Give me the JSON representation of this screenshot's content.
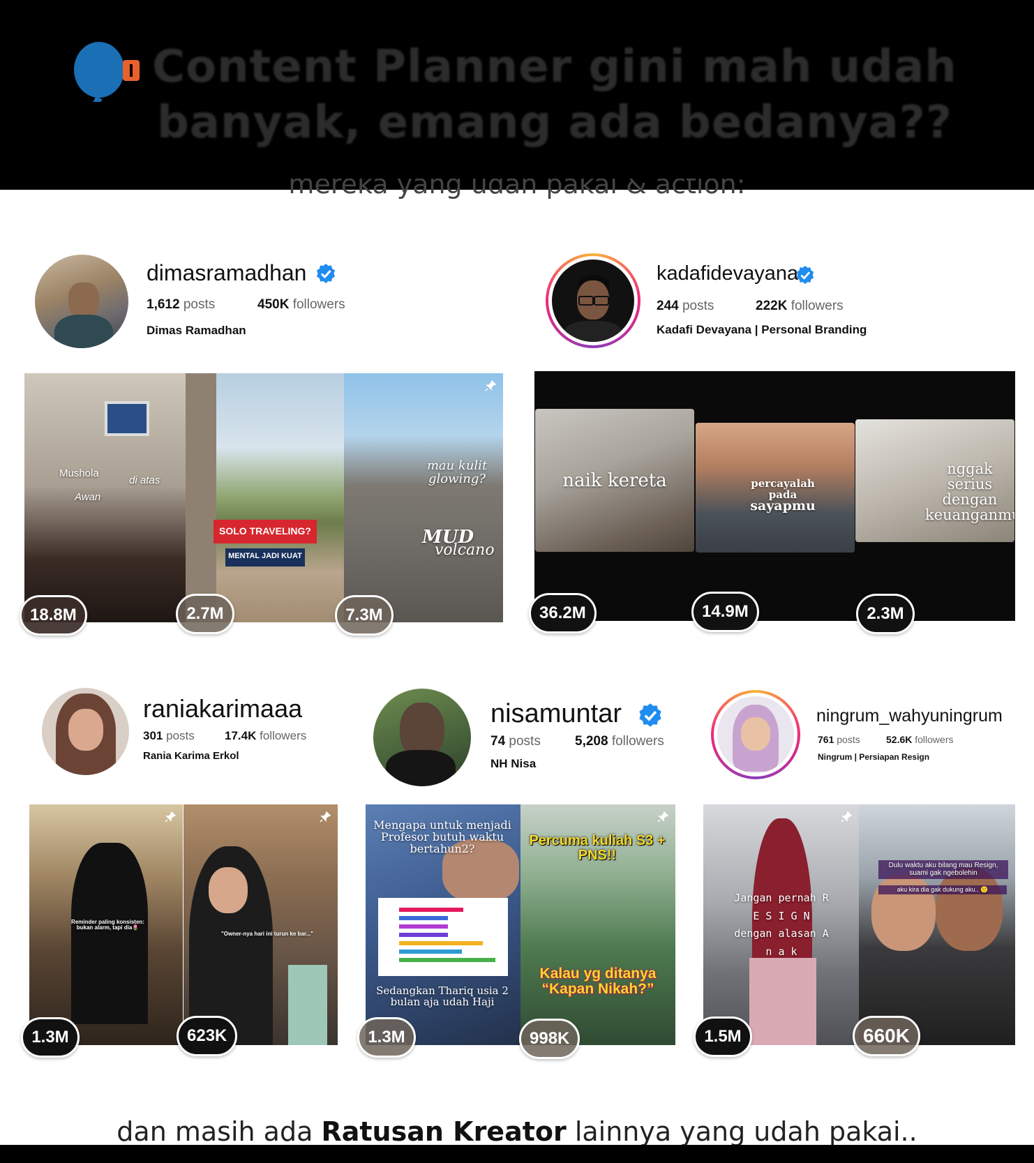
{
  "header": {
    "headline_line1": "Content Planner gini mah udah",
    "headline_line2": "banyak, emang ada bedanya??",
    "subline": "mereka yang udah pakai & action:"
  },
  "profiles": [
    {
      "username": "dimasramadhan",
      "posts": "1,612",
      "posts_label": "posts",
      "followers": "450K",
      "followers_label": "followers",
      "display_name": "Dimas Ramadhan",
      "verified": true,
      "thumbs": [
        {
          "views": "18.8M"
        },
        {
          "views": "2.7M"
        },
        {
          "views": "7.3M"
        }
      ]
    },
    {
      "username": "kadafidevayana",
      "posts": "244",
      "posts_label": "posts",
      "followers": "222K",
      "followers_label": "followers",
      "display_name": "Kadafi Devayana | Personal Branding",
      "verified": true,
      "thumbs": [
        {
          "views": "36.2M"
        },
        {
          "views": "14.9M"
        },
        {
          "views": "2.3M"
        }
      ]
    },
    {
      "username": "raniakarimaaa",
      "posts": "301",
      "posts_label": "posts",
      "followers": "17.4K",
      "followers_label": "followers",
      "display_name": "Rania Karima Erkol",
      "verified": false,
      "thumbs": [
        {
          "views": "1.3M"
        },
        {
          "views": "623K"
        }
      ]
    },
    {
      "username": "nisamuntar",
      "posts": "74",
      "posts_label": "posts",
      "followers": "5,208",
      "followers_label": "followers",
      "display_name": "NH Nisa",
      "verified": true,
      "thumbs": [
        {
          "views": "1.3M"
        },
        {
          "views": "998K"
        }
      ]
    },
    {
      "username": "ningrum_wahyuningrum",
      "posts": "761",
      "posts_label": "posts",
      "followers": "52.6K",
      "followers_label": "followers",
      "display_name": "Ningrum | Persiapan Resign",
      "verified": false,
      "thumbs": [
        {
          "views": "1.5M"
        },
        {
          "views": "660K"
        }
      ]
    }
  ],
  "overlays": {
    "d1_a": "Mushola",
    "d1_b": "Awan",
    "d1_c": "di atas",
    "d2_a": "SOLO TRAVELING?",
    "d2_b": "MENTAL JADI KUAT",
    "d3_a": "mau kulit glowing?",
    "d3_b": "MUD",
    "d3_c": "volcano",
    "k1": "naik kereta",
    "k2_a": "percayalah pada",
    "k2_b": "sayapmu",
    "k3": "nggak serius dengan keuanganmu.",
    "r1": "Reminder paling konsisten: bukan alarm, tapi dia🌷",
    "r2": "\"Owner-nya hari ini turun ke bar...\"",
    "n1_a": "Mengapa untuk menjadi Profesor butuh waktu bertahun2?",
    "n1_b": "Sedangkan Thariq usia 2 bulan aja udah Haji",
    "n2_a": "Percuma kuliah S3 + PNS!!",
    "n2_b": "Kalau yg ditanya “Kapan Nikah?”",
    "g1": "Jangan pernah R E S I G N dengan alasan A n a k",
    "g2": "Dulu waktu aku bilang mau Resign, suami gak ngebolehin",
    "g2_b": "aku kira dia gak dukung aku.. 🙁"
  },
  "footer": {
    "prefix": "dan masih ada ",
    "bold": "Ratusan Kreator",
    "suffix": " lainnya yang udah pakai.."
  },
  "colors": {
    "verified": "#1f8cf0",
    "accent": "#e8612c",
    "brand": "#1a6fb5"
  }
}
